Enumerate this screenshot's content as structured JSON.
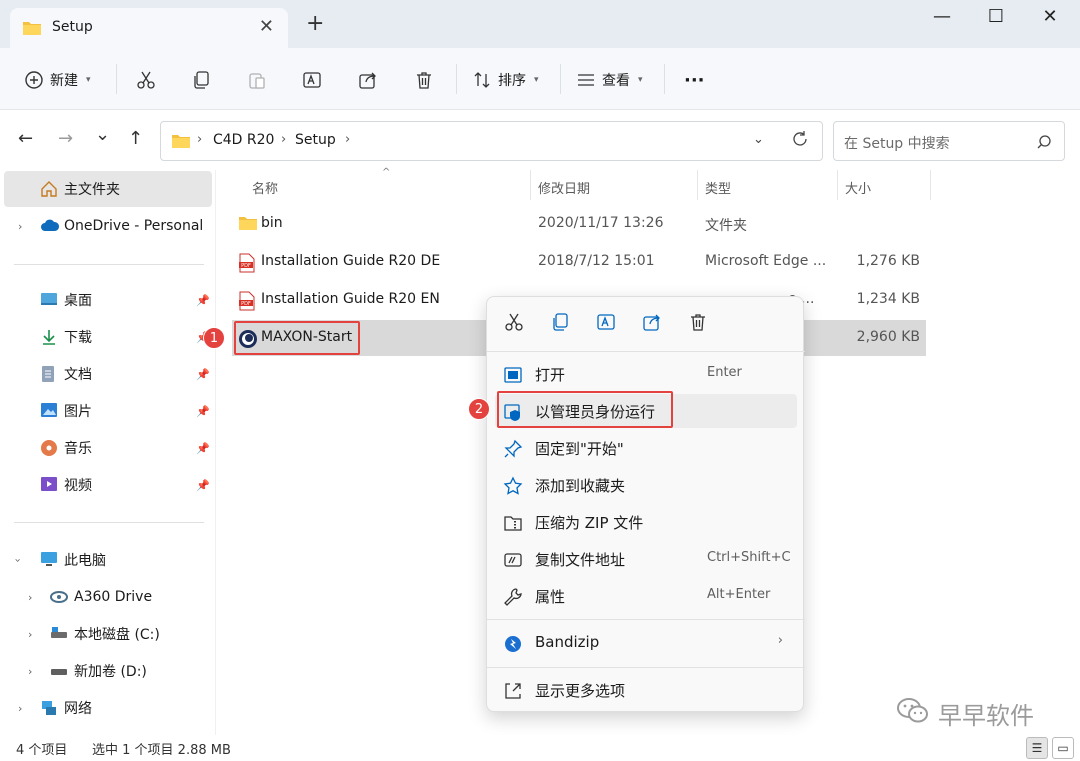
{
  "window": {
    "tab_title": "Setup",
    "tab_close": "✕",
    "new_tab": "+",
    "minimize": "—",
    "maximize": "☐",
    "close": "✕"
  },
  "toolbar": {
    "new_label": "新建",
    "sort_label": "排序",
    "view_label": "查看",
    "more_label": "···"
  },
  "navigation": {
    "back": "←",
    "forward": "→",
    "recent": "⌄",
    "up": "↑",
    "breadcrumbs": [
      "C4D R20",
      "Setup"
    ],
    "crumb_sep": "›",
    "search_placeholder": "在 Setup 中搜索"
  },
  "sidebar": {
    "items": [
      {
        "label": "主文件夹",
        "icon": "home-icon"
      },
      {
        "label": "OneDrive - Personal",
        "icon": "cloud-icon"
      },
      {
        "label": "桌面",
        "icon": "desktop-icon"
      },
      {
        "label": "下载",
        "icon": "download-icon"
      },
      {
        "label": "文档",
        "icon": "document-icon"
      },
      {
        "label": "图片",
        "icon": "picture-icon"
      },
      {
        "label": "音乐",
        "icon": "music-icon"
      },
      {
        "label": "视频",
        "icon": "video-icon"
      },
      {
        "label": "此电脑",
        "icon": "pc-icon"
      },
      {
        "label": "A360 Drive",
        "icon": "drive-icon"
      },
      {
        "label": "本地磁盘 (C:)",
        "icon": "disk-icon"
      },
      {
        "label": "新加卷 (D:)",
        "icon": "disk-icon"
      },
      {
        "label": "网络",
        "icon": "network-icon"
      }
    ]
  },
  "file_list": {
    "columns": [
      "名称",
      "修改日期",
      "类型",
      "大小"
    ],
    "sort_arrow": "^",
    "rows": [
      {
        "name": "bin",
        "date": "2020/11/17 13:26",
        "type": "文件夹",
        "size": "",
        "icon": "folder-icon"
      },
      {
        "name": "Installation Guide R20 DE",
        "date": "2018/7/12 15:01",
        "type": "Microsoft Edge ...",
        "size": "1,276 KB",
        "icon": "pdf-icon"
      },
      {
        "name": "Installation Guide R20 EN",
        "date": "",
        "type": "e ...",
        "size": "1,234 KB",
        "icon": "pdf-icon"
      },
      {
        "name": "MAXON-Start",
        "date": "",
        "type": "",
        "size": "2,960 KB",
        "icon": "cinema4d-icon"
      }
    ]
  },
  "annotations": {
    "step1": "1",
    "step2": "2"
  },
  "context_menu": {
    "icon_buttons": [
      "cut-icon",
      "copy-icon",
      "rename-icon",
      "share-icon",
      "delete-icon"
    ],
    "items": [
      {
        "label": "打开",
        "shortcut": "Enter",
        "icon": "open-icon"
      },
      {
        "label": "以管理员身份运行",
        "shortcut": "",
        "icon": "shield-icon"
      },
      {
        "label": "固定到\"开始\"",
        "shortcut": "",
        "icon": "pin-icon"
      },
      {
        "label": "添加到收藏夹",
        "shortcut": "",
        "icon": "star-icon"
      },
      {
        "label": "压缩为 ZIP 文件",
        "shortcut": "",
        "icon": "zip-icon"
      },
      {
        "label": "复制文件地址",
        "shortcut": "Ctrl+Shift+C",
        "icon": "path-icon"
      },
      {
        "label": "属性",
        "shortcut": "Alt+Enter",
        "icon": "wrench-icon"
      },
      {
        "label": "Bandizip",
        "shortcut": "",
        "icon": "bandizip-icon",
        "submenu": "›"
      },
      {
        "label": "显示更多选项",
        "shortcut": "",
        "icon": "more-options-icon"
      }
    ]
  },
  "status": {
    "item_count": "4 个项目",
    "selection": "选中 1 个项目  2.88 MB"
  },
  "watermark": {
    "text": "早早软件"
  },
  "colors": {
    "accent": "#0067c0",
    "annotation_red": "#e3423f",
    "selection_gray": "#d9d9d9"
  }
}
